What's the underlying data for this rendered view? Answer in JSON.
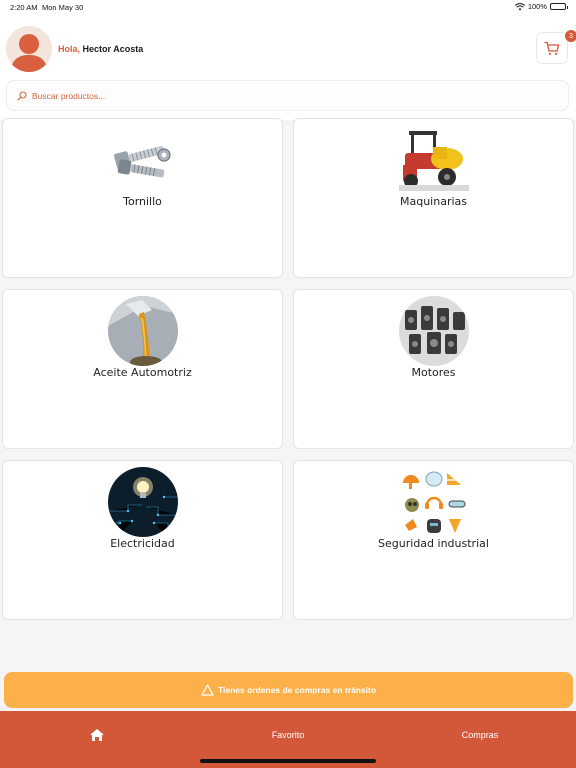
{
  "status_bar": {
    "time": "2:20 AM",
    "date": "Mon May 30",
    "battery": "100%"
  },
  "header": {
    "greeting": "Hola,",
    "user_name": "Hector Acosta",
    "cart_count": "3"
  },
  "search": {
    "placeholder": "Buscar productos..."
  },
  "categories": [
    {
      "label": "Tornillo",
      "icon": "bolts-image"
    },
    {
      "label": "Maquinarias",
      "icon": "machinery-image"
    },
    {
      "label": "Aceite Automotriz",
      "icon": "oil-pour-image"
    },
    {
      "label": "Motores",
      "icon": "engines-image"
    },
    {
      "label": "Electricidad",
      "icon": "lightbulb-image"
    },
    {
      "label": "Seguridad industrial",
      "icon": "safety-equipment-image"
    }
  ],
  "alert": {
    "text": "Tienes ordenes de compras en tránsito"
  },
  "bottom_nav": {
    "favorites": "Favorito",
    "purchases": "Compras"
  },
  "colors": {
    "brand": "#d3583a",
    "alert": "#fbb04a",
    "accent_text": "#d46540"
  }
}
